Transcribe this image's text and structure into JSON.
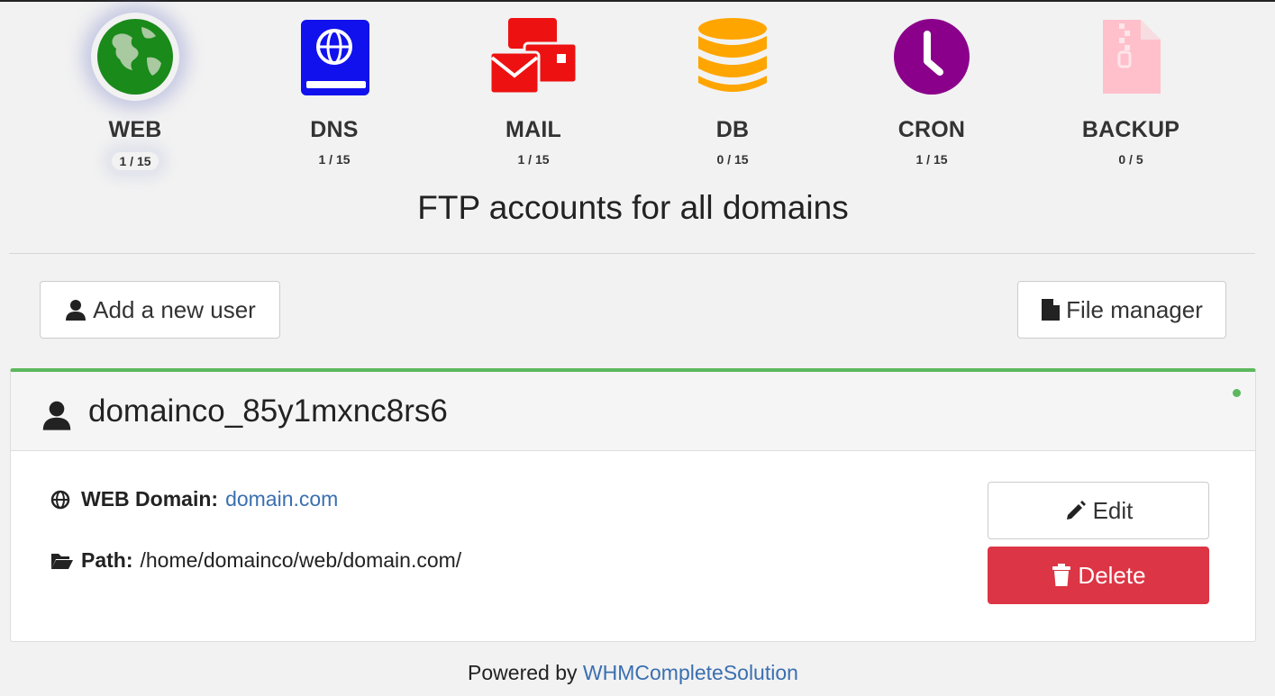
{
  "services": [
    {
      "name": "WEB",
      "count": "1 / 15",
      "color": "#1a8a1a",
      "icon": "globe-icon"
    },
    {
      "name": "DNS",
      "count": "1 / 15",
      "color": "#1111ee",
      "icon": "dns-book-icon"
    },
    {
      "name": "MAIL",
      "count": "1 / 15",
      "color": "#ee1111",
      "icon": "mail-icon"
    },
    {
      "name": "DB",
      "count": "0 / 15",
      "color": "#ffa500",
      "icon": "database-icon"
    },
    {
      "name": "CRON",
      "count": "1 / 15",
      "color": "#8b008b",
      "icon": "clock-icon"
    },
    {
      "name": "BACKUP",
      "count": "0 / 5",
      "color": "#ffc0cb",
      "icon": "zip-file-icon"
    }
  ],
  "page_title": "FTP accounts for all domains",
  "toolbar": {
    "add_user_label": "Add a new user",
    "file_manager_label": "File manager"
  },
  "account": {
    "username": "domainco_85y1mxnc8rs6",
    "status_color": "#5cb85c",
    "web_domain_label": "WEB Domain:",
    "web_domain_value": "domain.com",
    "path_label": "Path:",
    "path_value": "/home/domainco/web/domain.com/",
    "edit_label": "Edit",
    "delete_label": "Delete"
  },
  "footer": {
    "prefix": "Powered by",
    "link_text": "WHMCompleteSolution"
  }
}
